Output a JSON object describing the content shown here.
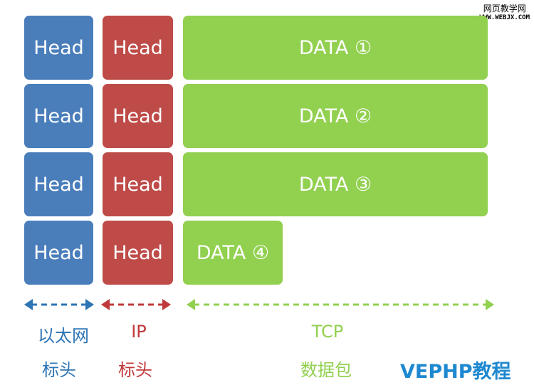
{
  "watermark": {
    "title": "网页教学网",
    "url": "WWW.WEBJX.COM"
  },
  "rows": [
    {
      "ethernet": "Head",
      "ip": "Head",
      "tcp": "DATA ①"
    },
    {
      "ethernet": "Head",
      "ip": "Head",
      "tcp": "DATA ②"
    },
    {
      "ethernet": "Head",
      "ip": "Head",
      "tcp": "DATA ③"
    },
    {
      "ethernet": "Head",
      "ip": "Head",
      "tcp": "DATA ④"
    }
  ],
  "legend": {
    "ethernet": {
      "line1": "以太网",
      "line2": "标头",
      "color": "#2e75b6"
    },
    "ip": {
      "line1": "IP",
      "line2": "标头",
      "color": "#c0393b"
    },
    "tcp": {
      "line1": "TCP",
      "line2": "数据包",
      "color": "#92d050"
    }
  },
  "brand": "VEPHP教程",
  "colors": {
    "ethernet_box": "#4a7ebb",
    "ip_box": "#be4b48",
    "tcp_box": "#92d050"
  }
}
